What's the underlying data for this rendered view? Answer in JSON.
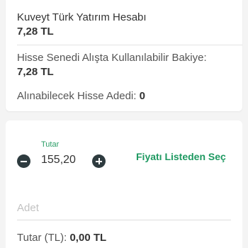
{
  "account": {
    "name": "Kuveyt Türk Yatırım Hesabı",
    "balance": "7,28 TL"
  },
  "available_balance": {
    "label": "Hisse Senedi Alışta Kullanılabilir Bakiye:",
    "value": "7,28 TL"
  },
  "purchasable_shares": {
    "label": "Alınabilecek Hisse Adedi:",
    "value": "0"
  },
  "price_stepper": {
    "caption": "Tutar",
    "value": "155,20",
    "decrement_icon": "minus-circle-icon",
    "increment_icon": "plus-circle-icon"
  },
  "pick_from_list_label": "Fiyatı Listeden Seç",
  "quantity_input": {
    "placeholder": "Adet",
    "value": ""
  },
  "total": {
    "label": "Tutar (TL):",
    "value": "0,00 TL"
  },
  "colors": {
    "accent": "#1e9961",
    "stepper_button": "#2e3b3f",
    "background": "#f4f4f4"
  }
}
